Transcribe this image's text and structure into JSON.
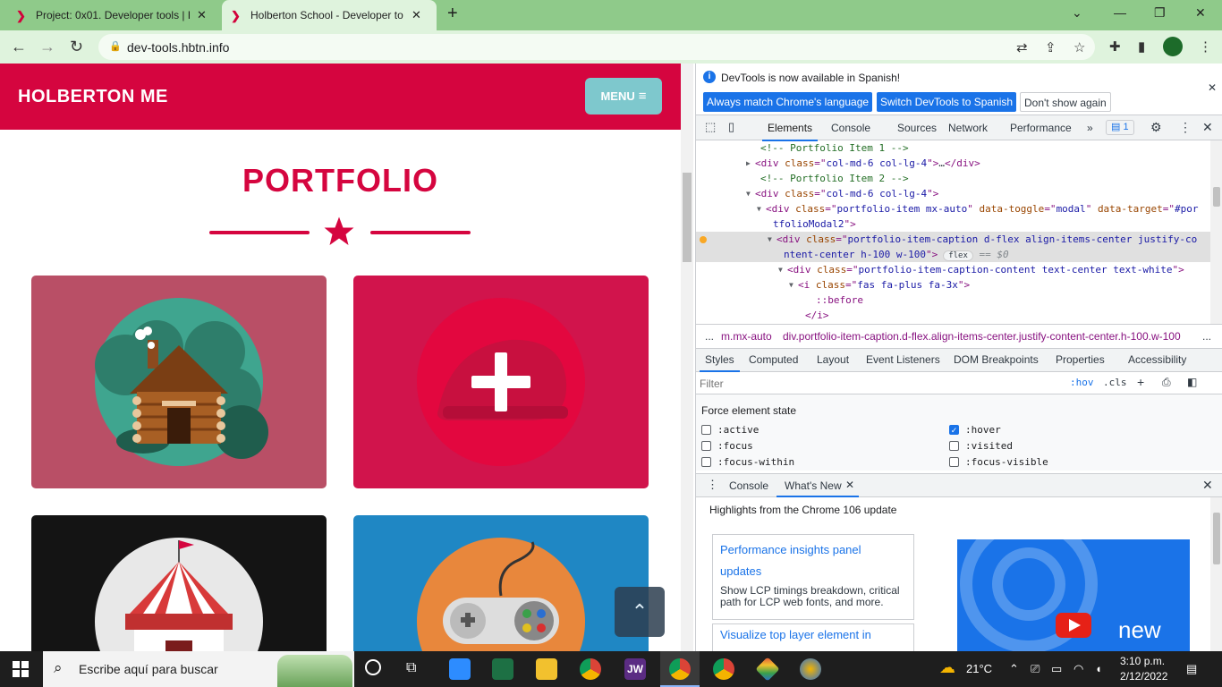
{
  "browser": {
    "tabs": [
      {
        "title": "Project: 0x01. Developer tools | H",
        "active": false
      },
      {
        "title": "Holberton School - Developer to",
        "active": true
      }
    ],
    "url": "dev-tools.hbtn.info"
  },
  "site": {
    "brand": "HOLBERTON ME",
    "menu_label": "MENU",
    "portfolio_title": "PORTFOLIO",
    "scroll_top_icon": "chevron-up-icon"
  },
  "devtools": {
    "infobar": {
      "message": "DevTools is now available in Spanish!",
      "btn_match": "Always match Chrome's language",
      "btn_switch": "Switch DevTools to Spanish",
      "btn_dismiss": "Don't show again"
    },
    "tabs": [
      "Elements",
      "Console",
      "Sources",
      "Network",
      "Performance"
    ],
    "issues_count": "1",
    "dom": [
      {
        "indent": 72,
        "arrow": "",
        "parts": [
          [
            "cmt",
            "<!-- Portfolio Item 1 -->"
          ]
        ]
      },
      {
        "indent": 66,
        "arrow": "▶",
        "parts": [
          [
            "tag",
            "<div "
          ],
          [
            "an",
            "class"
          ],
          [
            "tag",
            "=\""
          ],
          [
            "av",
            "col-md-6 col-lg-4"
          ],
          [
            "tag",
            "\">"
          ],
          [
            "txt",
            "…"
          ],
          [
            "tag",
            "</div>"
          ]
        ]
      },
      {
        "indent": 72,
        "arrow": "",
        "parts": [
          [
            "cmt",
            "<!-- Portfolio Item 2 -->"
          ]
        ]
      },
      {
        "indent": 66,
        "arrow": "▼",
        "parts": [
          [
            "tag",
            "<div "
          ],
          [
            "an",
            "class"
          ],
          [
            "tag",
            "=\""
          ],
          [
            "av",
            "col-md-6 col-lg-4"
          ],
          [
            "tag",
            "\">"
          ]
        ]
      },
      {
        "indent": 78,
        "arrow": "▼",
        "parts": [
          [
            "tag",
            "<div "
          ],
          [
            "an",
            "class"
          ],
          [
            "tag",
            "=\""
          ],
          [
            "av",
            "portfolio-item mx-auto"
          ],
          [
            "tag",
            "\" "
          ],
          [
            "an",
            "data-toggle"
          ],
          [
            "tag",
            "=\""
          ],
          [
            "av",
            "modal"
          ],
          [
            "tag",
            "\" "
          ],
          [
            "an",
            "data-target"
          ],
          [
            "tag",
            "=\""
          ],
          [
            "av",
            "#por"
          ]
        ]
      },
      {
        "indent": 86,
        "arrow": "",
        "parts": [
          [
            "av",
            "tfolioModal2"
          ],
          [
            "tag",
            "\">"
          ]
        ]
      },
      {
        "indent": 90,
        "arrow": "▼",
        "hl": true,
        "parts": [
          [
            "tag",
            "<div "
          ],
          [
            "an",
            "class"
          ],
          [
            "tag",
            "=\""
          ],
          [
            "av",
            "portfolio-item-caption d-flex align-items-center justify-co"
          ]
        ]
      },
      {
        "indent": 98,
        "arrow": "",
        "hl": true,
        "parts": [
          [
            "av",
            "ntent-center h-100 w-100"
          ],
          [
            "tag",
            "\">"
          ]
        ],
        "badge": "flex",
        "eq": "== $0"
      },
      {
        "indent": 102,
        "arrow": "▼",
        "parts": [
          [
            "tag",
            "<div "
          ],
          [
            "an",
            "class"
          ],
          [
            "tag",
            "=\""
          ],
          [
            "av",
            "portfolio-item-caption-content text-center text-white"
          ],
          [
            "tag",
            "\">"
          ]
        ]
      },
      {
        "indent": 114,
        "arrow": "▼",
        "parts": [
          [
            "tag",
            "<i "
          ],
          [
            "an",
            "class"
          ],
          [
            "tag",
            "=\""
          ],
          [
            "av",
            "fas fa-plus fa-3x"
          ],
          [
            "tag",
            "\">"
          ]
        ]
      },
      {
        "indent": 134,
        "arrow": "",
        "parts": [
          [
            "tag",
            "::before"
          ]
        ]
      },
      {
        "indent": 122,
        "arrow": "",
        "parts": [
          [
            "tag",
            "</i>"
          ]
        ]
      }
    ],
    "breadcrumbs": {
      "more": "...",
      "item1": "m.mx-auto",
      "item2": "div.portfolio-item-caption.d-flex.align-items-center.justify-content-center.h-100.w-100",
      "more_right": "..."
    },
    "styles_tabs": [
      "Styles",
      "Computed",
      "Layout",
      "Event Listeners",
      "DOM Breakpoints",
      "Properties",
      "Accessibility"
    ],
    "filter_placeholder": "Filter",
    "hov": ":hov",
    "cls": ".cls",
    "force_title": "Force element state",
    "states": [
      {
        "label": ":active",
        "checked": false
      },
      {
        "label": ":hover",
        "checked": true
      },
      {
        "label": ":focus",
        "checked": false
      },
      {
        "label": ":visited",
        "checked": false
      },
      {
        "label": ":focus-within",
        "checked": false
      },
      {
        "label": ":focus-visible",
        "checked": false
      }
    ],
    "drawer": {
      "tab_console": "Console",
      "tab_whatsnew": "What's New",
      "highlights": "Highlights from the Chrome 106 update",
      "card1_title_1": "Performance insights panel",
      "card1_title_2": "updates",
      "card1_body": "Show LCP timings breakdown, critical path for LCP web fonts, and more.",
      "card2_title": "Visualize top layer element in",
      "video_text": "new"
    }
  },
  "taskbar": {
    "search_placeholder": "Escribe aquí para buscar",
    "weather": "21°C",
    "time": "3:10 p.m.",
    "date": "2/12/2022"
  },
  "colors": {
    "brand_red": "#d5053f",
    "menu_teal": "#7ec8cd",
    "chrome_green": "#8fca8a",
    "devtools_blue": "#1a73e8"
  }
}
